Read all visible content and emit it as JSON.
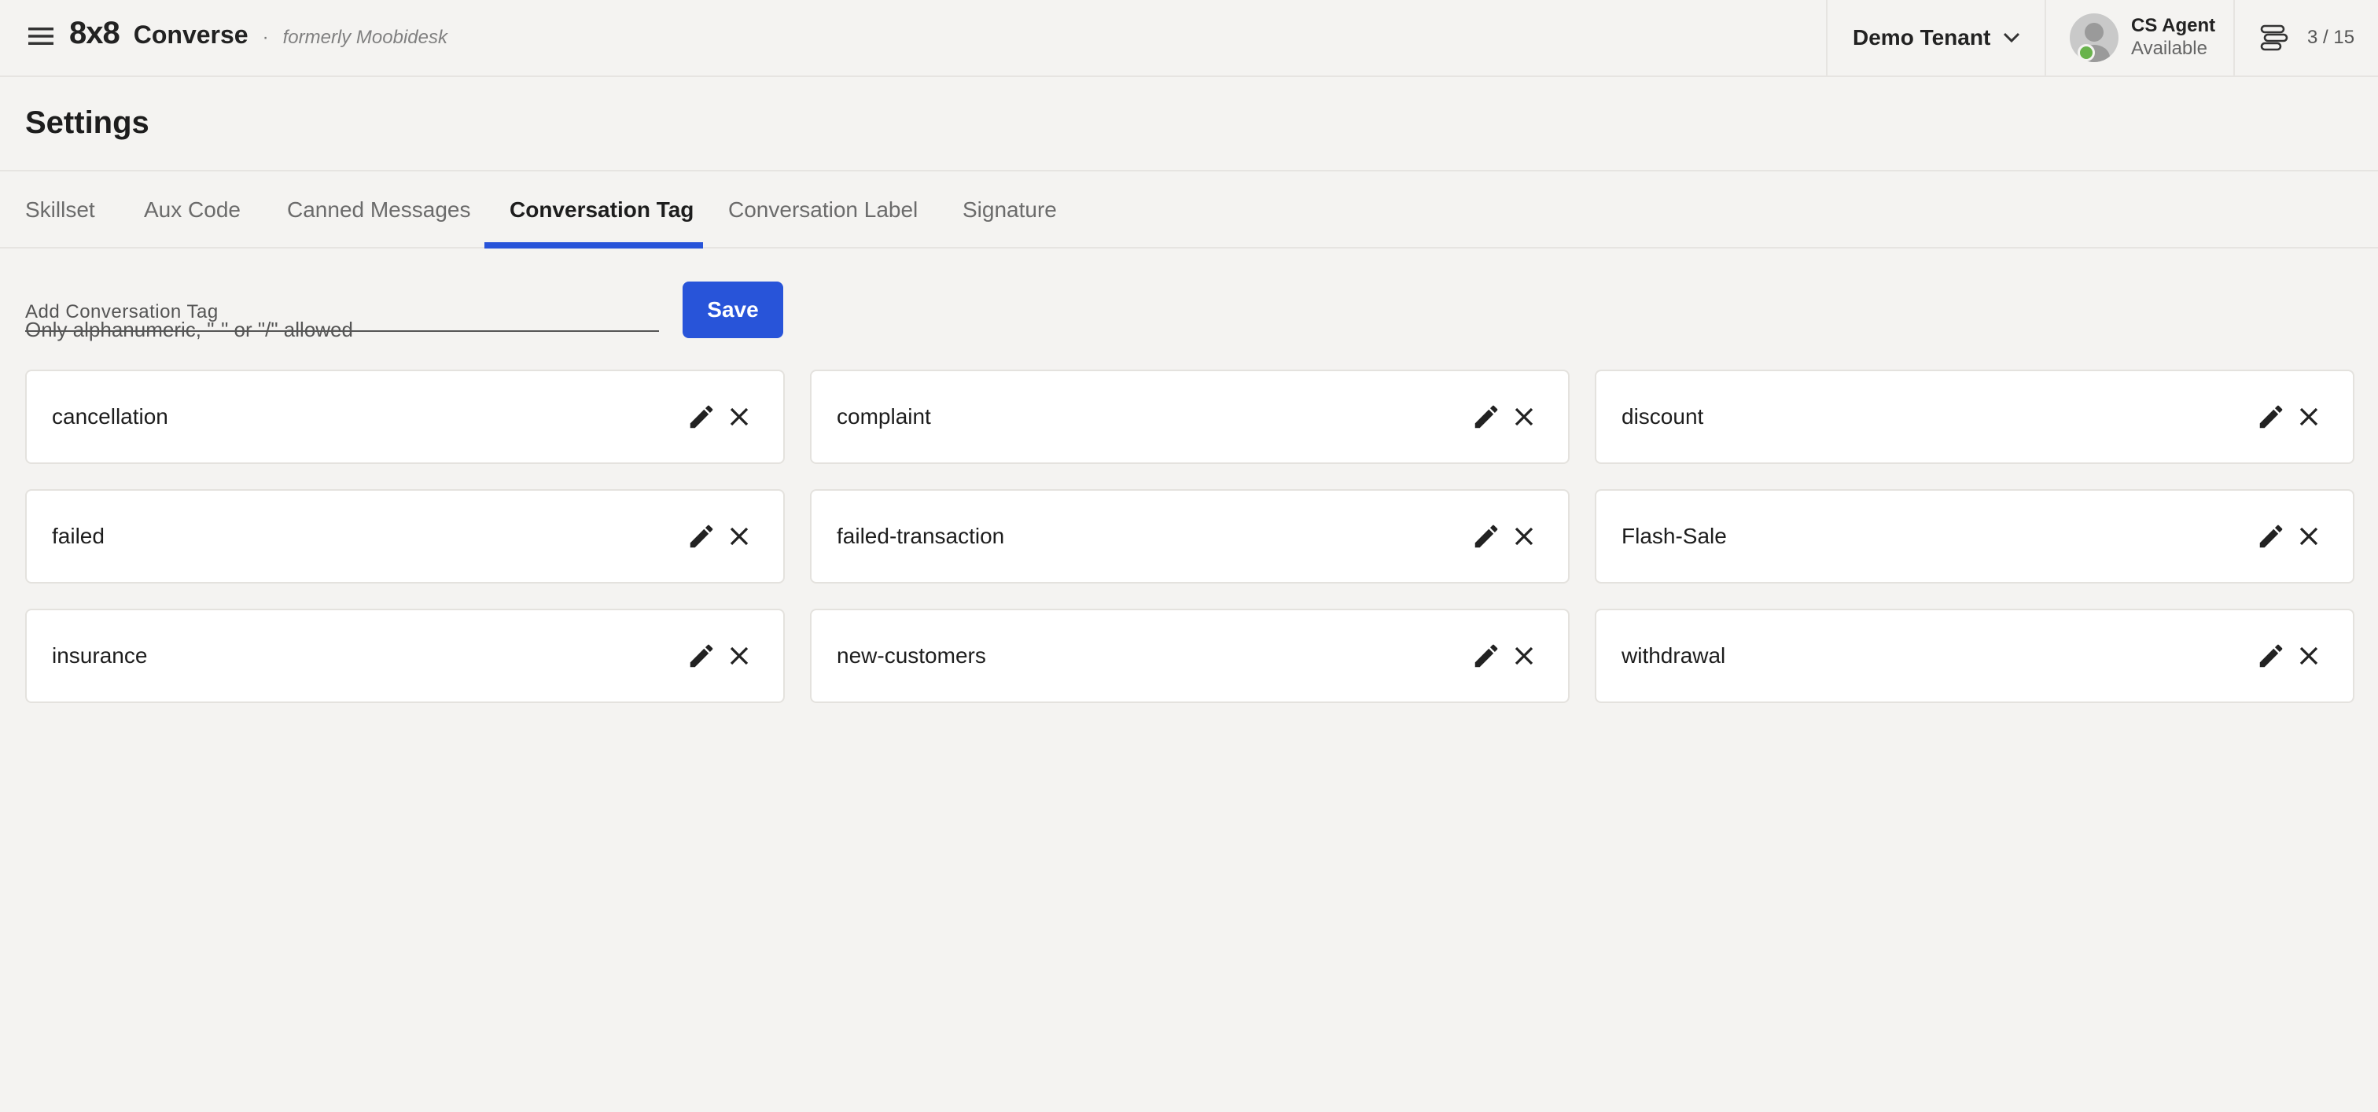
{
  "header": {
    "brand_logo": "8x8",
    "brand_name": "Converse",
    "brand_separator": "·",
    "brand_subtitle": "formerly Moobidesk",
    "tenant": "Demo Tenant",
    "agent_name": "CS Agent",
    "agent_status": "Available",
    "queue_count": "3 / 15"
  },
  "page": {
    "title": "Settings"
  },
  "tabs": [
    {
      "label": "Skillset"
    },
    {
      "label": "Aux Code"
    },
    {
      "label": "Canned Messages"
    },
    {
      "label": "Conversation Tag",
      "active": true
    },
    {
      "label": "Conversation Label"
    },
    {
      "label": "Signature"
    }
  ],
  "form": {
    "placeholder": "Add Conversation Tag",
    "value": "",
    "hint": "Only alphanumeric, \"-\" or \"/\" allowed",
    "save_label": "Save"
  },
  "tags": [
    {
      "label": "cancellation"
    },
    {
      "label": "complaint"
    },
    {
      "label": "discount"
    },
    {
      "label": "failed"
    },
    {
      "label": "failed-transaction"
    },
    {
      "label": "Flash-Sale"
    },
    {
      "label": "insurance"
    },
    {
      "label": "new-customers"
    },
    {
      "label": "withdrawal"
    }
  ],
  "colors": {
    "accent": "#2854d9",
    "background": "#f4f3f1",
    "status_available": "#69b34c"
  },
  "icons": {
    "menu": "hamburger-menu-icon",
    "tenant_dropdown": "chevron-down-icon",
    "queue": "queue-icon",
    "edit": "pencil-icon",
    "delete": "close-icon"
  }
}
